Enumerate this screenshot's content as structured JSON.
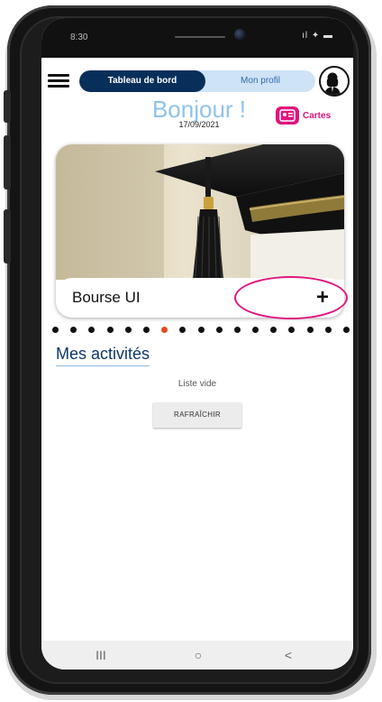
{
  "status_bar": {
    "time": "8:30",
    "icons": "ıl ✦ ▬"
  },
  "header": {
    "menu_icon": "menu-icon",
    "tabs": [
      {
        "label": "Tableau de bord",
        "active": true
      },
      {
        "label": "Mon profil",
        "active": false
      }
    ],
    "avatar_icon": "user-avatar-icon"
  },
  "greeting": {
    "title": "Bonjour !",
    "date": "17/09/2021"
  },
  "cards_button": {
    "label": "Cartes",
    "icon": "id-card-icon"
  },
  "carousel": {
    "card_title": "Bourse UI",
    "add_icon": "+",
    "dots_total": 17,
    "active_dot": 6
  },
  "activities": {
    "title": "Mes activités",
    "empty_text": "Liste vide",
    "refresh_label": "RAFRAÎCHIR"
  },
  "nav_bar": {
    "recent": "III",
    "home": "○",
    "back": "<"
  },
  "colors": {
    "primary": "#082f5a",
    "accent": "#e0147e",
    "active_dot": "#e64a19",
    "greeting": "#8fc3ec"
  }
}
